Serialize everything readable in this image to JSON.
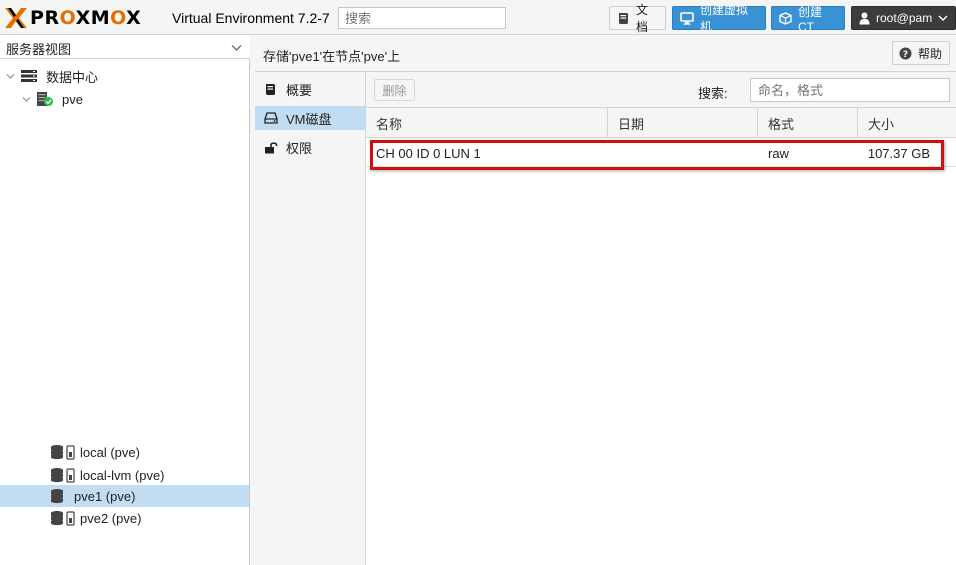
{
  "header": {
    "logo_text": "PROXMOX",
    "version": "Virtual Environment 7.2-7",
    "search_placeholder": "搜索",
    "docs_label": "文档",
    "create_vm_label": "创建虚拟机",
    "create_ct_label": "创建CT",
    "user_label": "root@pam"
  },
  "sidebar": {
    "view_label": "服务器视图",
    "tree": {
      "datacenter": "数据中心",
      "node": "pve",
      "storages": [
        {
          "label": "local (pve)",
          "selected": false
        },
        {
          "label": "local-lvm (pve)",
          "selected": false
        },
        {
          "label": "pve1 (pve)",
          "selected": true
        },
        {
          "label": "pve2 (pve)",
          "selected": false
        }
      ]
    }
  },
  "content": {
    "title": "存储'pve1'在节点'pve'上",
    "help_label": "帮助",
    "nav": [
      {
        "label": "概要",
        "icon": "book-icon",
        "active": false
      },
      {
        "label": "VM磁盘",
        "icon": "hdd-icon",
        "active": true
      },
      {
        "label": "权限",
        "icon": "unlock-icon",
        "active": false
      }
    ],
    "toolbar": {
      "delete_label": "删除",
      "search_label": "搜索:",
      "search_placeholder": "命名，格式"
    },
    "grid": {
      "columns": [
        "名称",
        "日期",
        "格式",
        "大小"
      ],
      "rows": [
        {
          "name": "CH 00 ID 0 LUN 1",
          "date": "",
          "format": "raw",
          "size": "107.37 GB"
        }
      ]
    }
  },
  "colors": {
    "accent_blue": "#3892d4",
    "selection": "#c2ddf2",
    "logo_orange": "#e57000",
    "highlight_red": "#cc1111"
  }
}
